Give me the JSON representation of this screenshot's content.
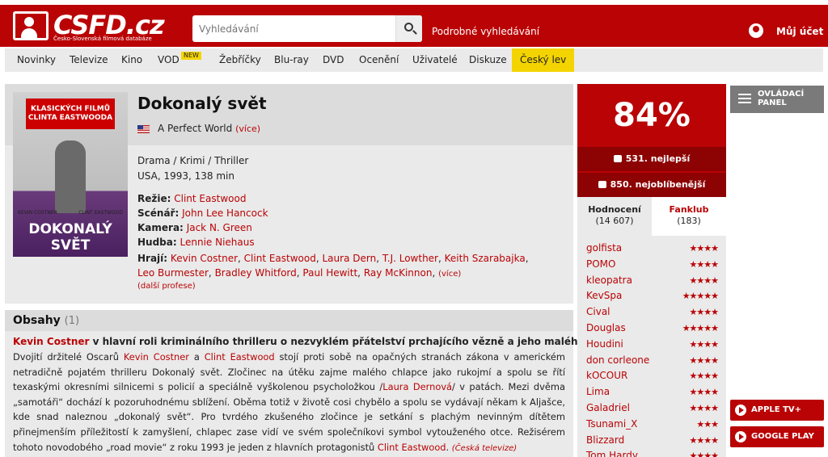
{
  "header": {
    "logo_text": "CSFD.cz",
    "logo_sub": "Česko-Slovenská filmová databáze",
    "search_placeholder": "Vyhledávání",
    "advanced_search": "Podrobné vyhledávání",
    "account_label": "Můj účet"
  },
  "nav": {
    "items": [
      "Novinky",
      "Televize",
      "Kino",
      "VOD",
      "Žebříčky",
      "Blu-ray",
      "DVD",
      "Ocenění",
      "Uživatelé",
      "Diskuze",
      "Český lev"
    ],
    "vod_badge": "NEW"
  },
  "film": {
    "title": "Dokonalý svět",
    "alt_title": "A Perfect World",
    "alt_more": "(více)",
    "genres": "Drama / Krimi / Thriller",
    "origin": "USA, 1993, 138 min",
    "directing_label": "Režie:",
    "directing": "Clint Eastwood",
    "screenplay_label": "Scénář:",
    "screenplay": "John Lee Hancock",
    "camera_label": "Kamera:",
    "camera": "Jack N. Green",
    "music_label": "Hudba:",
    "music": "Lennie Niehaus",
    "actors_label": "Hrají:",
    "actors": [
      "Kevin Costner",
      "Clint Eastwood",
      "Laura Dern",
      "T.J. Lowther",
      "Keith Szarabajka",
      "Leo Burmester",
      "Bradley Whitford",
      "Paul Hewitt",
      "Ray McKinnon"
    ],
    "actors_more": "(více)",
    "more_professions": "(další profese)",
    "poster": {
      "banner": "KLASICKÝCH FILMŮ CLINTA EASTWOODA",
      "actor_left": "KEVIN COSTNER",
      "actor_right": "CLINT EASTWOOD",
      "title": "DOKONALÝ SVĚT"
    }
  },
  "plot": {
    "heading": "Obsahy",
    "count": "(1)",
    "lead_name": "Kevin Costner",
    "lead_text": " v hlavní roli kriminálního thrilleru o nezvyklém přátelství prchajícího vězně a jeho malého rukojmí.",
    "p1": "Dvojití držitelé Oscarů ",
    "name1": "Kevin Costner",
    "p2": " a ",
    "name2": "Clint Eastwood",
    "p3": " stojí proti sobě na opačných stranách zákona v americkém netradičně pojatém thrilleru Dokonalý svět. Zločinec na útěku zajme malého chlapce jako rukojmí a spolu se řítí texaskými okresními silnicemi s policií a speciálně vyškolenou psycholožkou /",
    "name3": "Laura Dernová",
    "p4": "/ v patách. Mezi dvěma „samotáři“ dochází k pozoruhodnému sblížení. Oběma totiž v životě cosi chybělo a spolu se vydávají někam k Aljašce, kde snad naleznou „dokonalý svět“. Pro tvrdého zkušeného zločince je setkání s plachým nevinným dítětem přinejmenším příležitostí k zamyšlení, chlapec zase vidí ve svém společníkovi symbol vytouženého otce. Režisérem tohoto novodobého „road movie“ z roku 1993 je jeden z hlavních protagonistů ",
    "name4": "Clint Eastwood",
    "p5": ". ",
    "source": "(Česká televize)"
  },
  "rating": {
    "percent": "84%",
    "best": "531. nejlepší",
    "favorite": "850. nejoblíbenější",
    "tab_ratings": "Hodnocení",
    "tab_ratings_count": "(14 607)",
    "tab_fanclub": "Fanklub",
    "tab_fanclub_count": "(183)"
  },
  "user_ratings": [
    {
      "name": "golfista",
      "stars": 4
    },
    {
      "name": "POMO",
      "stars": 4
    },
    {
      "name": "kleopatra",
      "stars": 4
    },
    {
      "name": "KevSpa",
      "stars": 5
    },
    {
      "name": "Cival",
      "stars": 4
    },
    {
      "name": "Douglas",
      "stars": 5
    },
    {
      "name": "Houdini",
      "stars": 4
    },
    {
      "name": "don corleone",
      "stars": 4
    },
    {
      "name": "kOCOUR",
      "stars": 4
    },
    {
      "name": "Lima",
      "stars": 4
    },
    {
      "name": "Galadriel",
      "stars": 4
    },
    {
      "name": "Tsunami_X",
      "stars": 3
    },
    {
      "name": "Blizzard",
      "stars": 4
    },
    {
      "name": "Tom Hardy",
      "stars": 4
    }
  ],
  "side": {
    "panel_label": "OVLÁDACÍ PANEL",
    "apple": "APPLE TV+",
    "google": "GOOGLE PLAY"
  }
}
